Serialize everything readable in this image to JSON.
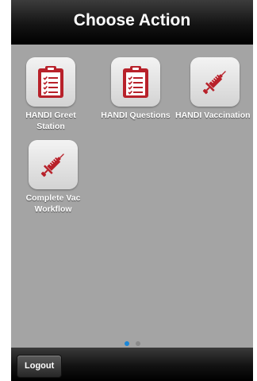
{
  "navbar": {
    "title": "Choose Action"
  },
  "actions": [
    {
      "label_line1": "HANDI Greet",
      "label_line2": "Station",
      "icon": "clipboard-icon"
    },
    {
      "label_line1": "HANDI Questions",
      "label_line2": "",
      "icon": "clipboard-icon"
    },
    {
      "label_line1": "HANDI Vaccination",
      "label_line2": "",
      "icon": "syringe-icon"
    },
    {
      "label_line1": "Complete Vac",
      "label_line2": "Workflow",
      "icon": "syringe-icon"
    }
  ],
  "pager": {
    "page_count": 2,
    "current_page": 1
  },
  "toolbar": {
    "logout_label": "Logout"
  },
  "colors": {
    "icon_red": "#b8212a",
    "dot_active": "#1a86d8",
    "dot_inactive": "#8a8a8a",
    "background": "#a4a4a4"
  }
}
